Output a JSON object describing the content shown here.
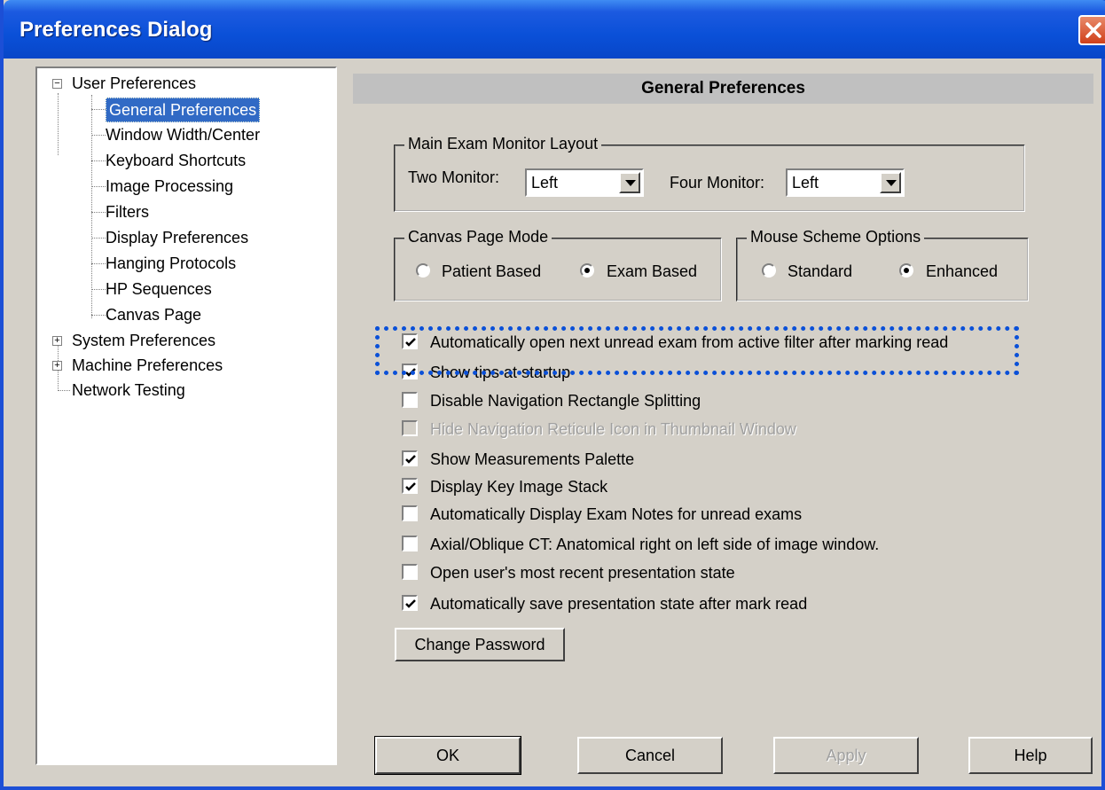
{
  "window": {
    "title": "Preferences Dialog"
  },
  "tree": {
    "user_preferences": "User Preferences",
    "children": [
      "General Preferences",
      "Window Width/Center",
      "Keyboard Shortcuts",
      "Image Processing",
      "Filters",
      "Display Preferences",
      "Hanging Protocols",
      "HP Sequences",
      "Canvas Page"
    ],
    "system_preferences": "System Preferences",
    "machine_preferences": "Machine Preferences",
    "network_testing": "Network Testing",
    "selected": "General Preferences"
  },
  "panel": {
    "header": "General Preferences"
  },
  "monitor_layout": {
    "legend": "Main Exam Monitor Layout",
    "two_monitor_label": "Two Monitor:",
    "two_monitor_value": "Left",
    "four_monitor_label": "Four Monitor:",
    "four_monitor_value": "Left"
  },
  "canvas_page_mode": {
    "legend": "Canvas Page Mode",
    "option_patient": "Patient Based",
    "option_exam": "Exam Based",
    "selected": "Exam Based"
  },
  "mouse_scheme": {
    "legend": "Mouse Scheme Options",
    "option_standard": "Standard",
    "option_enhanced": "Enhanced",
    "selected": "Enhanced"
  },
  "checkboxes": [
    {
      "label": "Automatically open next unread exam from active filter after marking read",
      "checked": true,
      "enabled": true
    },
    {
      "label": "Show tips at startup",
      "checked": true,
      "enabled": true
    },
    {
      "label": "Disable Navigation Rectangle Splitting",
      "checked": false,
      "enabled": true
    },
    {
      "label": "Hide Navigation Reticule Icon in Thumbnail Window",
      "checked": false,
      "enabled": false
    },
    {
      "label": "Show Measurements Palette",
      "checked": true,
      "enabled": true
    },
    {
      "label": "Display Key Image Stack",
      "checked": true,
      "enabled": true
    },
    {
      "label": "Automatically Display Exam Notes for unread exams",
      "checked": false,
      "enabled": true
    },
    {
      "label": "Axial/Oblique CT: Anatomical right on left side of image window.",
      "checked": false,
      "enabled": true
    },
    {
      "label": "Open user's most recent presentation state",
      "checked": false,
      "enabled": true
    },
    {
      "label": "Automatically save presentation state after mark read",
      "checked": true,
      "enabled": true
    }
  ],
  "buttons": {
    "change_password": "Change Password",
    "ok": "OK",
    "cancel": "Cancel",
    "apply": "Apply",
    "help": "Help"
  }
}
